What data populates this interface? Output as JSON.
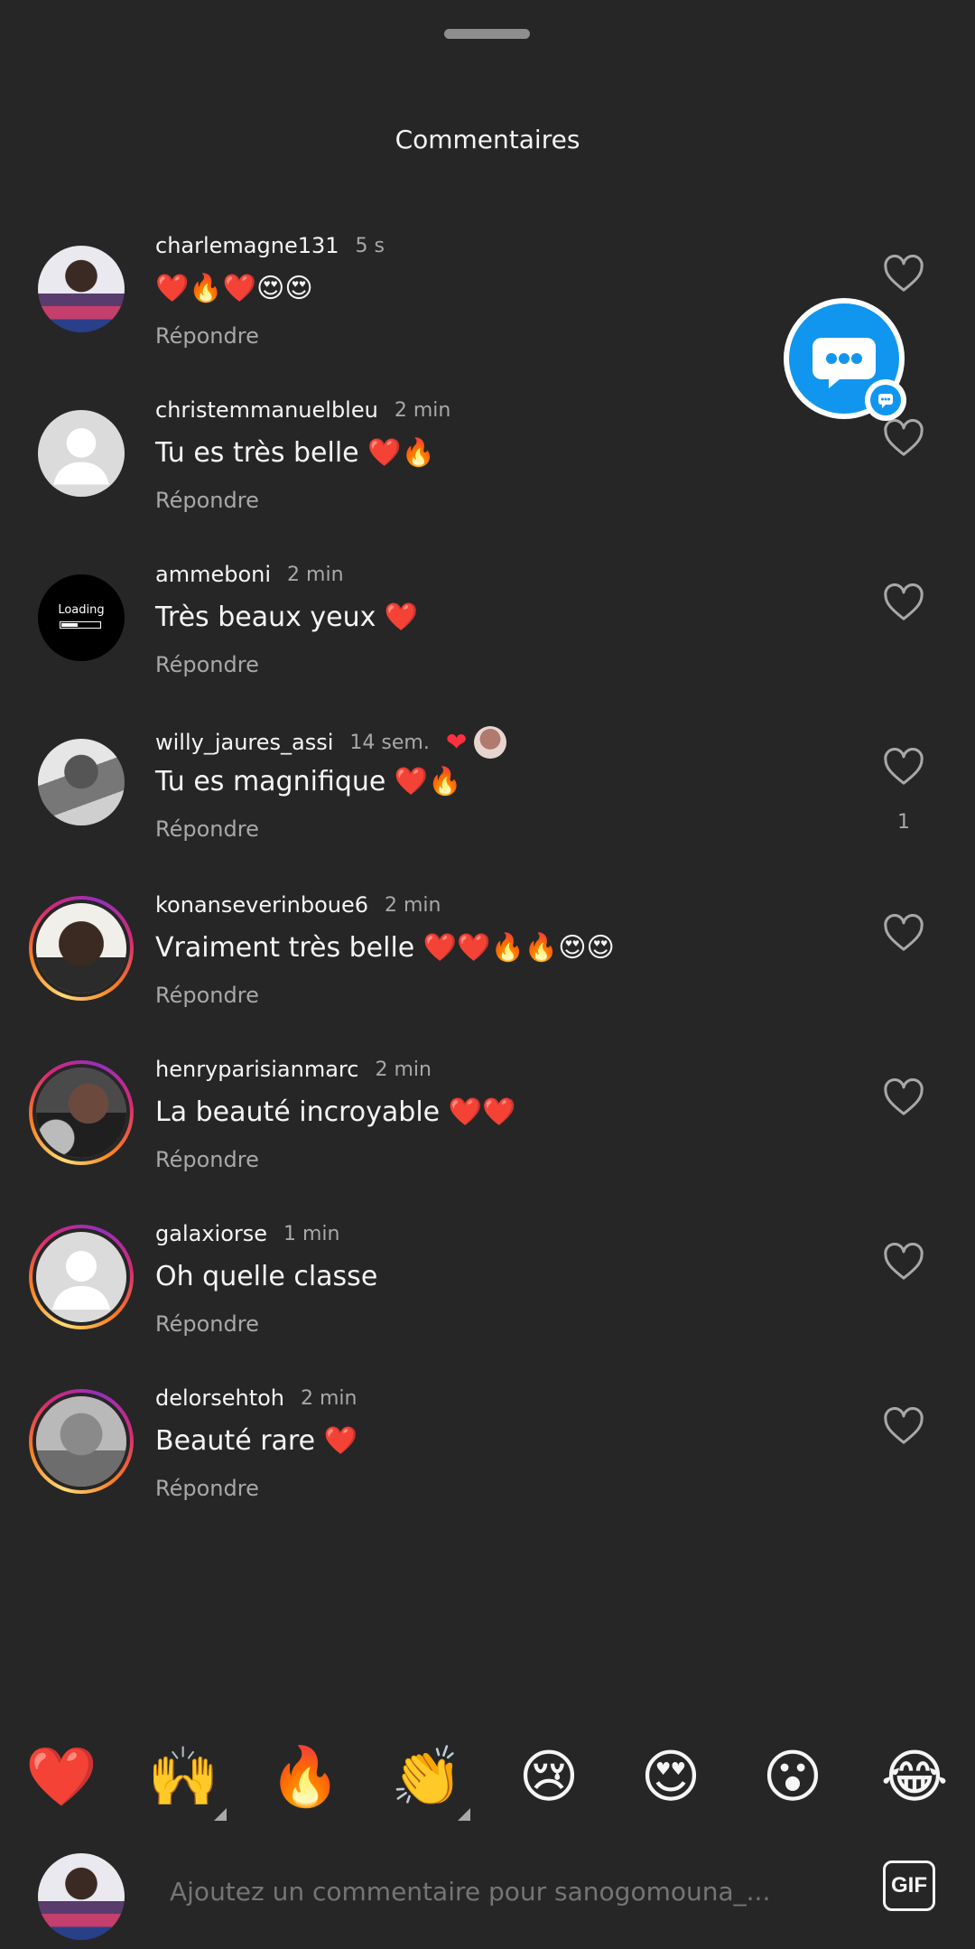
{
  "sheet": {
    "title": "Commentaires"
  },
  "comments": [
    {
      "username": "charlemagne131",
      "time": "5 s",
      "text": "❤️🔥❤️😍😍",
      "reply": "Répondre",
      "avatar": "photo-1",
      "story_ring": false
    },
    {
      "username": "christemmanuelbleu",
      "time": "2 min",
      "text": "Tu es très belle ❤️🔥",
      "reply": "Répondre",
      "avatar": "default",
      "story_ring": false
    },
    {
      "username": "ammeboni",
      "time": "2 min",
      "text": "Très beaux yeux ❤️",
      "reply": "Répondre",
      "avatar": "loading",
      "avatar_text": "Loading",
      "story_ring": false
    },
    {
      "username": "willy_jaures_assi",
      "time": "14 sem.",
      "text": "Tu es magnifique ❤️🔥",
      "reply": "Répondre",
      "avatar": "photo-2",
      "story_ring": false,
      "author_liked": true,
      "likes": "1"
    },
    {
      "username": "konanseverinboue6",
      "time": "2 min",
      "text": "Vraiment très belle ❤️❤️🔥🔥😍😍",
      "reply": "Répondre",
      "avatar": "photo-3",
      "story_ring": true
    },
    {
      "username": "henryparisianmarc",
      "time": "2 min",
      "text": "La beauté  incroyable ❤️❤️",
      "reply": "Répondre",
      "avatar": "photo-4",
      "story_ring": true
    },
    {
      "username": "galaxiorse",
      "time": "1 min",
      "text": "Oh quelle classe",
      "reply": "Répondre",
      "avatar": "default",
      "story_ring": true
    },
    {
      "username": "delorsehtoh",
      "time": "2 min",
      "text": "Beauté rare ❤️",
      "reply": "Répondre",
      "avatar": "photo-5",
      "story_ring": true
    }
  ],
  "reactions": [
    {
      "emoji": "❤️",
      "has_variants": false
    },
    {
      "emoji": "🙌",
      "has_variants": true
    },
    {
      "emoji": "🔥",
      "has_variants": false
    },
    {
      "emoji": "👏",
      "has_variants": true
    },
    {
      "emoji": "😢",
      "has_variants": false
    },
    {
      "emoji": "😍",
      "has_variants": false
    },
    {
      "emoji": "😮",
      "has_variants": false
    },
    {
      "emoji": "😂",
      "has_variants": false
    }
  ],
  "composer": {
    "placeholder": "Ajoutez un commentaire pour sanogomouna_...",
    "gif_label": "GIF"
  },
  "floating_chat": {
    "icon": "chat-bubble-icon"
  },
  "colors": {
    "background": "#262626",
    "text_primary": "#f5f5f5",
    "text_secondary": "#a8a8a8",
    "like_heart": "#ff3040",
    "chat_blue": "#1196f0"
  }
}
